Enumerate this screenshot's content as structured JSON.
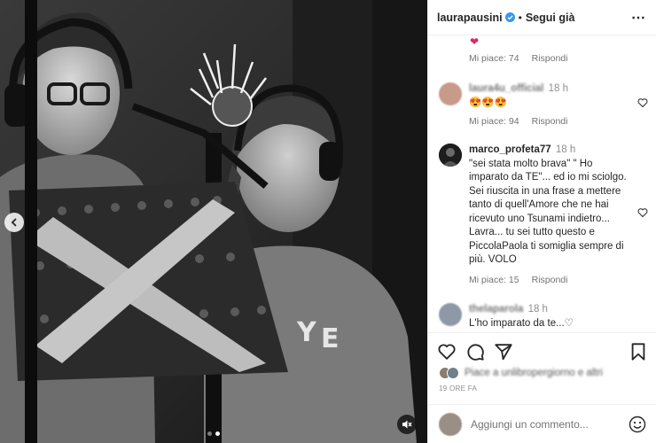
{
  "header": {
    "username": "laurapausini",
    "separator": "•",
    "follow_label": "Segui già",
    "more_label": "⋯"
  },
  "top_meta": {
    "emoji": "❤",
    "likes": "Mi piace: 74",
    "reply": "Rispondi"
  },
  "comments": [
    {
      "username": "laura4u_official",
      "time": "18 h",
      "text": "😍😍😍",
      "likes": "Mi piace: 94",
      "reply": "Rispondi"
    },
    {
      "username": "marco_profeta77",
      "time": "18 h",
      "text": "\"sei stata molto brava\" \" Ho imparato da TE\"... ed io mi sciolgo. Sei riuscita in una frase a mettere tanto di quell'Amore che ne hai ricevuto uno Tsunami indietro... Lavra... tu sei tutto questo e PiccolaPaola ti somiglia sempre di più. VOLO",
      "likes": "Mi piace: 15",
      "reply": "Rispondi"
    },
    {
      "username": "thelaparola",
      "time": "18 h",
      "text": "L'ho imparato da te...♡"
    }
  ],
  "actions": {
    "likes_text": "Piace a unlibropergiorno e altri",
    "posted": "19 ORE FA"
  },
  "add_comment": {
    "placeholder": "Aggiungi un commento..."
  },
  "colors": {
    "verified": "#3897f0",
    "heart": "#e0245e",
    "muted_text": "#737373"
  }
}
